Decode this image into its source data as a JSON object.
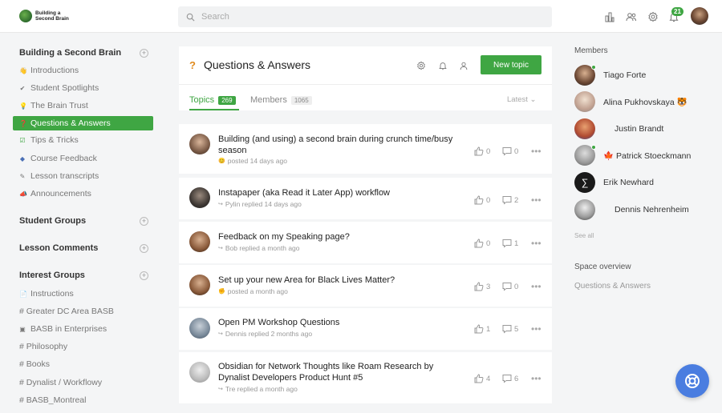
{
  "brand": {
    "name": "Building a Second Brain"
  },
  "search": {
    "placeholder": "Search"
  },
  "notifications": {
    "count": "21"
  },
  "sidebar": {
    "sections": [
      {
        "title": "Building a Second Brain"
      },
      {
        "title": "Student Groups"
      },
      {
        "title": "Lesson Comments"
      },
      {
        "title": "Interest Groups"
      }
    ],
    "main_items": [
      {
        "label": "Introductions",
        "icon": "👋"
      },
      {
        "label": "Student Spotlights",
        "icon": "✔"
      },
      {
        "label": "The Brain Trust",
        "icon": "💡"
      },
      {
        "label": "Questions & Answers",
        "icon": "❓"
      },
      {
        "label": "Tips & Tricks",
        "icon": "☑"
      },
      {
        "label": "Course Feedback",
        "icon": "◆"
      },
      {
        "label": "Lesson transcripts",
        "icon": "✎"
      },
      {
        "label": "Announcements",
        "icon": "📣"
      }
    ],
    "interest_items": [
      {
        "label": "Instructions",
        "icon": "📄"
      },
      {
        "label": "# Greater DC Area BASB",
        "icon": ""
      },
      {
        "label": "BASB in Enterprises",
        "icon": "▣"
      },
      {
        "label": "# Philosophy",
        "icon": ""
      },
      {
        "label": "# Books",
        "icon": ""
      },
      {
        "label": "# Dynalist / Workflowy",
        "icon": ""
      },
      {
        "label": "# BASB_Montreal",
        "icon": ""
      }
    ]
  },
  "space": {
    "icon": "?",
    "title": "Questions & Answers",
    "new_topic": "New topic"
  },
  "tabs": {
    "topics_label": "Topics",
    "topics_count": "269",
    "members_label": "Members",
    "members_count": "1065",
    "sort": "Latest"
  },
  "topics": [
    {
      "title": "Building (and using) a second brain during crunch time/busy season",
      "meta": "posted 14 days ago",
      "likes": "0",
      "comments": "0"
    },
    {
      "title": "Instapaper (aka Read it Later App) workflow",
      "meta": "Pylin replied 14 days ago",
      "likes": "0",
      "comments": "2"
    },
    {
      "title": "Feedback on my Speaking page?",
      "meta": "Bob replied a month ago",
      "likes": "0",
      "comments": "1"
    },
    {
      "title": "Set up your new Area for Black Lives Matter?",
      "meta": "posted a month ago",
      "likes": "3",
      "comments": "0"
    },
    {
      "title": "Open PM Workshop Questions",
      "meta": "Dennis replied 2 months ago",
      "likes": "1",
      "comments": "5"
    },
    {
      "title": "Obsidian for Network Thoughts like Roam Research by Dynalist Developers Product Hunt #5",
      "meta": "Tre replied a month ago",
      "likes": "4",
      "comments": "6"
    }
  ],
  "members": {
    "title": "Members",
    "list": [
      {
        "name": "Tiago Forte"
      },
      {
        "name": "Alina Pukhovskaya 🐯"
      },
      {
        "name": "Justin Brandt"
      },
      {
        "name": "🍁 Patrick Stoeckmann"
      },
      {
        "name": "Erik Newhard"
      },
      {
        "name": "Dennis Nehrenheim"
      }
    ],
    "see_all": "See all"
  },
  "space_overview": {
    "title": "Space overview",
    "link": "Questions & Answers"
  },
  "colors": {
    "accent": "#3fa643",
    "help": "#4a7de0"
  }
}
